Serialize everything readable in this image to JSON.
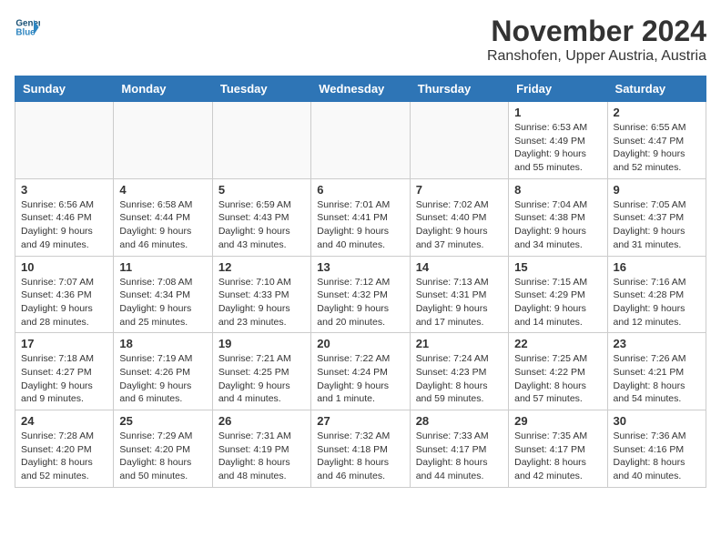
{
  "logo": {
    "line1": "General",
    "line2": "Blue"
  },
  "title": "November 2024",
  "location": "Ranshofen, Upper Austria, Austria",
  "weekdays": [
    "Sunday",
    "Monday",
    "Tuesday",
    "Wednesday",
    "Thursday",
    "Friday",
    "Saturday"
  ],
  "weeks": [
    [
      {
        "day": "",
        "info": ""
      },
      {
        "day": "",
        "info": ""
      },
      {
        "day": "",
        "info": ""
      },
      {
        "day": "",
        "info": ""
      },
      {
        "day": "",
        "info": ""
      },
      {
        "day": "1",
        "info": "Sunrise: 6:53 AM\nSunset: 4:49 PM\nDaylight: 9 hours\nand 55 minutes."
      },
      {
        "day": "2",
        "info": "Sunrise: 6:55 AM\nSunset: 4:47 PM\nDaylight: 9 hours\nand 52 minutes."
      }
    ],
    [
      {
        "day": "3",
        "info": "Sunrise: 6:56 AM\nSunset: 4:46 PM\nDaylight: 9 hours\nand 49 minutes."
      },
      {
        "day": "4",
        "info": "Sunrise: 6:58 AM\nSunset: 4:44 PM\nDaylight: 9 hours\nand 46 minutes."
      },
      {
        "day": "5",
        "info": "Sunrise: 6:59 AM\nSunset: 4:43 PM\nDaylight: 9 hours\nand 43 minutes."
      },
      {
        "day": "6",
        "info": "Sunrise: 7:01 AM\nSunset: 4:41 PM\nDaylight: 9 hours\nand 40 minutes."
      },
      {
        "day": "7",
        "info": "Sunrise: 7:02 AM\nSunset: 4:40 PM\nDaylight: 9 hours\nand 37 minutes."
      },
      {
        "day": "8",
        "info": "Sunrise: 7:04 AM\nSunset: 4:38 PM\nDaylight: 9 hours\nand 34 minutes."
      },
      {
        "day": "9",
        "info": "Sunrise: 7:05 AM\nSunset: 4:37 PM\nDaylight: 9 hours\nand 31 minutes."
      }
    ],
    [
      {
        "day": "10",
        "info": "Sunrise: 7:07 AM\nSunset: 4:36 PM\nDaylight: 9 hours\nand 28 minutes."
      },
      {
        "day": "11",
        "info": "Sunrise: 7:08 AM\nSunset: 4:34 PM\nDaylight: 9 hours\nand 25 minutes."
      },
      {
        "day": "12",
        "info": "Sunrise: 7:10 AM\nSunset: 4:33 PM\nDaylight: 9 hours\nand 23 minutes."
      },
      {
        "day": "13",
        "info": "Sunrise: 7:12 AM\nSunset: 4:32 PM\nDaylight: 9 hours\nand 20 minutes."
      },
      {
        "day": "14",
        "info": "Sunrise: 7:13 AM\nSunset: 4:31 PM\nDaylight: 9 hours\nand 17 minutes."
      },
      {
        "day": "15",
        "info": "Sunrise: 7:15 AM\nSunset: 4:29 PM\nDaylight: 9 hours\nand 14 minutes."
      },
      {
        "day": "16",
        "info": "Sunrise: 7:16 AM\nSunset: 4:28 PM\nDaylight: 9 hours\nand 12 minutes."
      }
    ],
    [
      {
        "day": "17",
        "info": "Sunrise: 7:18 AM\nSunset: 4:27 PM\nDaylight: 9 hours\nand 9 minutes."
      },
      {
        "day": "18",
        "info": "Sunrise: 7:19 AM\nSunset: 4:26 PM\nDaylight: 9 hours\nand 6 minutes."
      },
      {
        "day": "19",
        "info": "Sunrise: 7:21 AM\nSunset: 4:25 PM\nDaylight: 9 hours\nand 4 minutes."
      },
      {
        "day": "20",
        "info": "Sunrise: 7:22 AM\nSunset: 4:24 PM\nDaylight: 9 hours\nand 1 minute."
      },
      {
        "day": "21",
        "info": "Sunrise: 7:24 AM\nSunset: 4:23 PM\nDaylight: 8 hours\nand 59 minutes."
      },
      {
        "day": "22",
        "info": "Sunrise: 7:25 AM\nSunset: 4:22 PM\nDaylight: 8 hours\nand 57 minutes."
      },
      {
        "day": "23",
        "info": "Sunrise: 7:26 AM\nSunset: 4:21 PM\nDaylight: 8 hours\nand 54 minutes."
      }
    ],
    [
      {
        "day": "24",
        "info": "Sunrise: 7:28 AM\nSunset: 4:20 PM\nDaylight: 8 hours\nand 52 minutes."
      },
      {
        "day": "25",
        "info": "Sunrise: 7:29 AM\nSunset: 4:20 PM\nDaylight: 8 hours\nand 50 minutes."
      },
      {
        "day": "26",
        "info": "Sunrise: 7:31 AM\nSunset: 4:19 PM\nDaylight: 8 hours\nand 48 minutes."
      },
      {
        "day": "27",
        "info": "Sunrise: 7:32 AM\nSunset: 4:18 PM\nDaylight: 8 hours\nand 46 minutes."
      },
      {
        "day": "28",
        "info": "Sunrise: 7:33 AM\nSunset: 4:17 PM\nDaylight: 8 hours\nand 44 minutes."
      },
      {
        "day": "29",
        "info": "Sunrise: 7:35 AM\nSunset: 4:17 PM\nDaylight: 8 hours\nand 42 minutes."
      },
      {
        "day": "30",
        "info": "Sunrise: 7:36 AM\nSunset: 4:16 PM\nDaylight: 8 hours\nand 40 minutes."
      }
    ]
  ]
}
